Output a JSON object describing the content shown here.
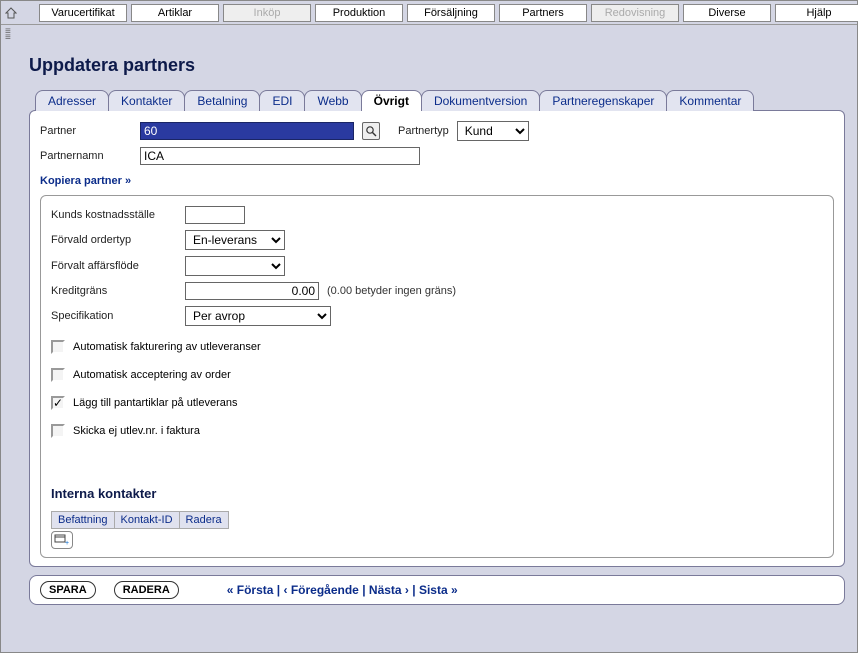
{
  "menus": {
    "items": [
      {
        "label": "Varucertifikat",
        "disabled": false
      },
      {
        "label": "Artiklar",
        "disabled": false
      },
      {
        "label": "Inköp",
        "disabled": true
      },
      {
        "label": "Produktion",
        "disabled": false
      },
      {
        "label": "Försäljning",
        "disabled": false
      },
      {
        "label": "Partners",
        "disabled": false
      },
      {
        "label": "Redovisning",
        "disabled": true
      },
      {
        "label": "Diverse",
        "disabled": false
      },
      {
        "label": "Hjälp",
        "disabled": false
      }
    ]
  },
  "page": {
    "title": "Uppdatera partners"
  },
  "tabs": [
    {
      "label": "Adresser",
      "active": false
    },
    {
      "label": "Kontakter",
      "active": false
    },
    {
      "label": "Betalning",
      "active": false
    },
    {
      "label": "EDI",
      "active": false
    },
    {
      "label": "Webb",
      "active": false
    },
    {
      "label": "Övrigt",
      "active": true
    },
    {
      "label": "Dokumentversion",
      "active": false
    },
    {
      "label": "Partneregenskaper",
      "active": false
    },
    {
      "label": "Kommentar",
      "active": false
    }
  ],
  "header": {
    "partner_label": "Partner",
    "partner_value": "60",
    "partnertyp_label": "Partnertyp",
    "partnertyp_value": "Kund",
    "partnernamn_label": "Partnernamn",
    "partnernamn_value": "ICA",
    "copy_link": "Kopiera partner »"
  },
  "form": {
    "kostnadsstalle_label": "Kunds kostnadsställe",
    "kostnadsstalle_value": "",
    "ordertyp_label": "Förvald ordertyp",
    "ordertyp_value": "En-leverans",
    "affarsflode_label": "Förvalt affärsflöde",
    "affarsflode_value": "",
    "kreditgrans_label": "Kreditgräns",
    "kreditgrans_value": "0.00",
    "kreditgrans_hint": "(0.00 betyder ingen gräns)",
    "specifikation_label": "Specifikation",
    "specifikation_value": "Per avrop"
  },
  "checks": [
    {
      "label": "Automatisk fakturering av utleveranser",
      "checked": false
    },
    {
      "label": "Automatisk acceptering av order",
      "checked": false
    },
    {
      "label": "Lägg till pantartiklar på utleverans",
      "checked": true
    },
    {
      "label": "Skicka ej utlev.nr. i faktura",
      "checked": false
    }
  ],
  "contacts": {
    "heading": "Interna kontakter",
    "cols": [
      "Befattning",
      "Kontakt-ID",
      "Radera"
    ]
  },
  "actions": {
    "save": "SPARA",
    "delete": "RADERA",
    "first": "« Första",
    "prev": "‹ Föregående",
    "next": "Nästa ›",
    "last": "Sista »"
  }
}
